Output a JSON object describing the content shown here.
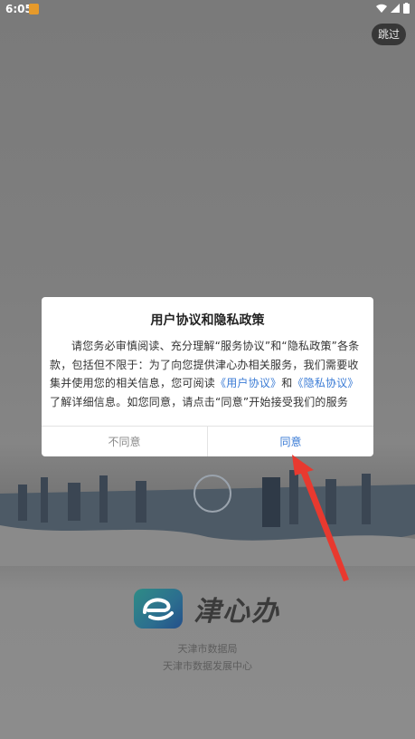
{
  "status_bar": {
    "time": "6:05"
  },
  "skip_button": "跳过",
  "dialog": {
    "title": "用户协议和隐私政策",
    "body_part1": "请您务必审慎阅读、充分理解“服务协议”和“隐私政策”各条款，包括但不限于：为了向您提供津心办相关服务，我们需要收集并使用您的相关信息，您可阅读",
    "link_user_agreement": "《用户协议》",
    "and_text": "和",
    "link_privacy": "《隐私协议》",
    "body_part2": "了解详细信息。如您同意，请点击“同意”开始接受我们的服务",
    "disagree_label": "不同意",
    "agree_label": "同意"
  },
  "brand": {
    "app_name": "津心办",
    "org_line1": "天津市数据局",
    "org_line2": "天津市数据发展中心"
  },
  "colors": {
    "link": "#3a7bd5",
    "annotation_arrow": "#e8392f"
  }
}
